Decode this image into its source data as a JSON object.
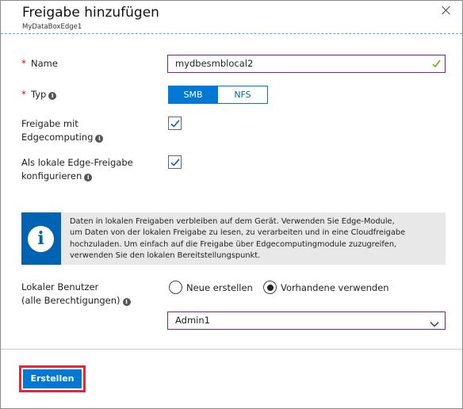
{
  "header": {
    "title": "Freigabe hinzufügen",
    "subtitle": "MyDataBoxEdge1"
  },
  "form": {
    "name": {
      "required_mark": "*",
      "label": "Name",
      "value": "mydbesmblocal2"
    },
    "type": {
      "required_mark": "*",
      "label": "Typ",
      "options": [
        "SMB",
        "NFS"
      ],
      "selected": "SMB"
    },
    "edge_compute": {
      "label_line1": "Freigabe mit",
      "label_line2": "Edgecomputing",
      "checked": true
    },
    "local_share": {
      "label_line1": "Als lokale Edge-Freigabe",
      "label_line2": "konfigurieren",
      "checked": true
    }
  },
  "info_box": {
    "line1": "Daten in lokalen Freigaben verbleiben auf dem Gerät. Verwenden Sie Edge-Module,",
    "line2": "um Daten von der lokalen Freigabe zu lesen, zu verarbeiten und in eine Cloudfreigabe",
    "line3": "hochzuladen. Um einfach auf die Freigabe über Edgecomputingmodule zuzugreifen,",
    "line4": "verwenden Sie den lokalen Bereitstellungspunkt."
  },
  "local_user": {
    "label_line1": "Lokaler Benutzer",
    "label_line2": "(alle Berechtigungen)",
    "option_new": "Neue erstellen",
    "option_existing": "Vorhandene verwenden",
    "selected": "Vorhandene verwenden",
    "dropdown_value": "Admin1"
  },
  "footer": {
    "create_label": "Erstellen"
  },
  "colors": {
    "accent": "#0078d4",
    "focus_border": "#7b1fa2",
    "highlight": "#e2263d",
    "valid": "#6bb700",
    "required": "#c50f1f"
  },
  "icons": [
    "close-icon",
    "valid-check-icon",
    "info-icon",
    "chevron-down-icon",
    "checkbox-check-icon"
  ]
}
